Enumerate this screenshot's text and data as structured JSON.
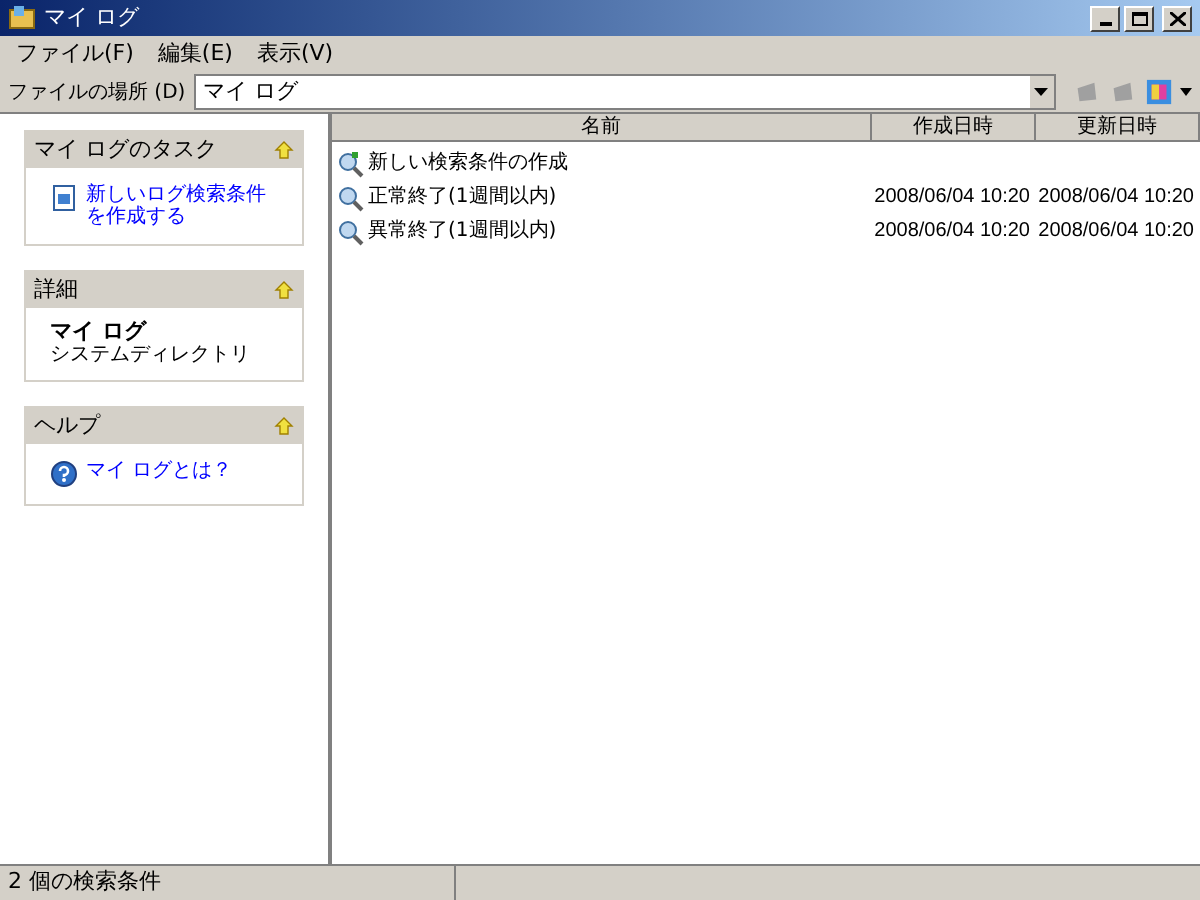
{
  "window": {
    "title": "マイ ログ"
  },
  "menu": [
    "ファイル(F)",
    "編集(E)",
    "表示(V)"
  ],
  "address": {
    "label": "ファイルの場所 (D)",
    "value": "マイ ログ"
  },
  "panels": [
    {
      "title": "マイ ログのタスク",
      "kind": "links",
      "items": [
        {
          "label": "新しいログ検索条件を作成する",
          "kind": "task"
        }
      ]
    },
    {
      "title": "詳細",
      "kind": "details",
      "name": "マイ ログ",
      "description": "システムディレクトリ"
    },
    {
      "title": "ヘルプ",
      "kind": "links",
      "items": [
        {
          "label": "マイ ログとは？",
          "kind": "help"
        }
      ]
    }
  ],
  "table": {
    "columns": [
      "名前",
      "作成日時",
      "更新日時"
    ],
    "rows": [
      {
        "name": "新しい検索条件の作成",
        "kind": "new"
      },
      {
        "name": "正常終了(1週間以内)",
        "kind": "saved",
        "created": "2008/06/04 10:20",
        "modified": "2008/06/04 10:20"
      },
      {
        "name": "異常終了(1週間以内)",
        "kind": "saved",
        "created": "2008/06/04 10:20",
        "modified": "2008/06/04 10:20"
      }
    ]
  },
  "status_bar": {
    "text": "2 個の検索条件"
  }
}
